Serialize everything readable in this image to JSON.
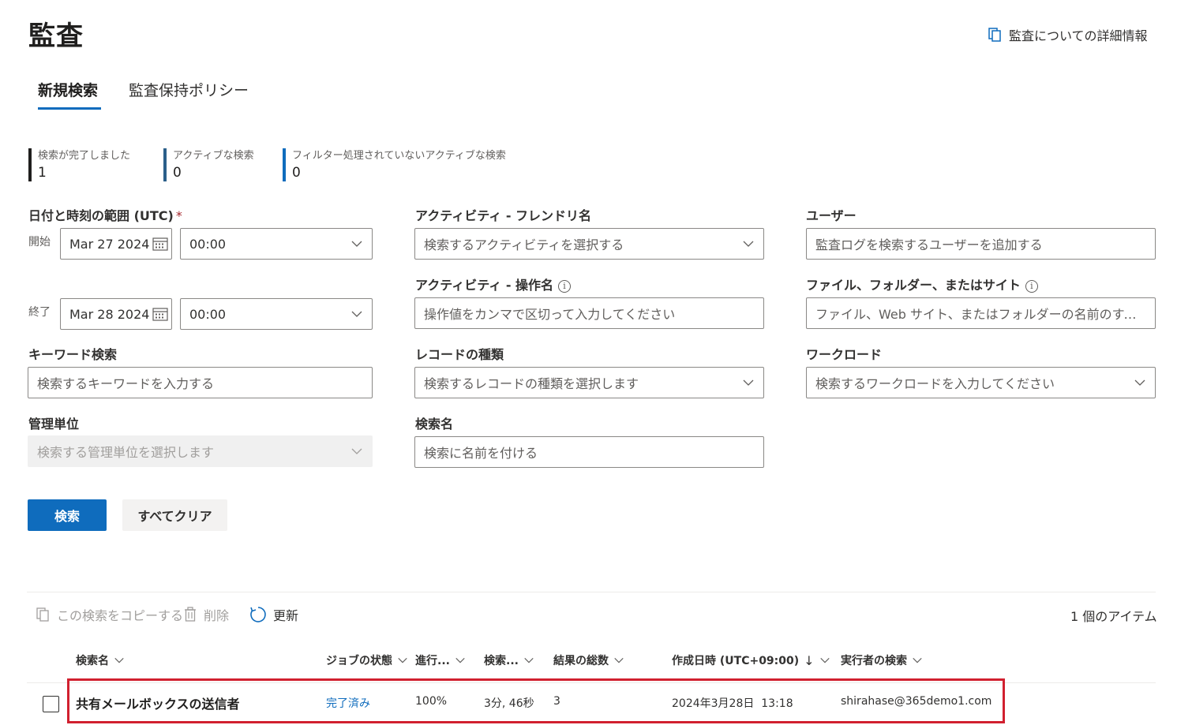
{
  "header": {
    "title": "監査",
    "learn_more_label": "監査についての詳細情報"
  },
  "tabs": [
    {
      "label": "新規検索",
      "selected": true
    },
    {
      "label": "監査保持ポリシー",
      "selected": false
    }
  ],
  "stats": [
    {
      "label": "検索が完了しました",
      "value": "1",
      "color": "#201f1e"
    },
    {
      "label": "アクティブな検索",
      "value": "0",
      "color": "#2b5f8a"
    },
    {
      "label": "フィルター処理されていないアクティブな検索",
      "value": "0",
      "color": "#0f6cbd"
    }
  ],
  "form": {
    "date_range": {
      "label": "日付と時刻の範囲 (UTC)",
      "required_mark": "*",
      "start_label": "開始",
      "start_date": "Mar 27 2024",
      "start_time": "00:00",
      "end_label": "終了",
      "end_date": "Mar 28 2024",
      "end_time": "00:00"
    },
    "keyword": {
      "label": "キーワード検索",
      "placeholder": "検索するキーワードを入力する"
    },
    "admin_unit": {
      "label": "管理単位",
      "placeholder": "検索する管理単位を選択します"
    },
    "activity_friendly": {
      "label": "アクティビティ - フレンドリ名",
      "placeholder": "検索するアクティビティを選択する"
    },
    "activity_operation": {
      "label": "アクティビティ - 操作名",
      "placeholder": "操作値をカンマで区切って入力してください"
    },
    "record_type": {
      "label": "レコードの種類",
      "placeholder": "検索するレコードの種類を選択します"
    },
    "search_name": {
      "label": "検索名",
      "placeholder": "検索に名前を付ける"
    },
    "users": {
      "label": "ユーザー",
      "placeholder": "監査ログを検索するユーザーを追加する"
    },
    "files": {
      "label": "ファイル、フォルダー、またはサイト",
      "placeholder": "ファイル、Web サイト、またはフォルダーの名前のすべてまたは..."
    },
    "workload": {
      "label": "ワークロード",
      "placeholder": "検索するワークロードを入力してください"
    },
    "info_glyph": "i"
  },
  "buttons": {
    "search": "検索",
    "clear_all": "すべてクリア"
  },
  "toolbar": {
    "copy": "この検索をコピーする",
    "delete": "削除",
    "refresh": "更新",
    "item_count": "1 個のアイテム"
  },
  "table": {
    "columns": [
      "検索名",
      "ジョブの状態",
      "進行...",
      "検索...",
      "結果の総数",
      "作成日時 (UTC+09:00)",
      "実行者の検索"
    ],
    "sort_arrow": "↓",
    "rows": [
      {
        "name": "共有メールボックスの送信者",
        "status": "完了済み",
        "progress": "100%",
        "duration": "3分, 46秒",
        "total": "3",
        "created": "2024年3月28日  13:18",
        "run_by": "shirahase@365demo1.com"
      }
    ]
  },
  "colors": {
    "accent": "#0f6cbd",
    "highlight": "#d1202f"
  }
}
